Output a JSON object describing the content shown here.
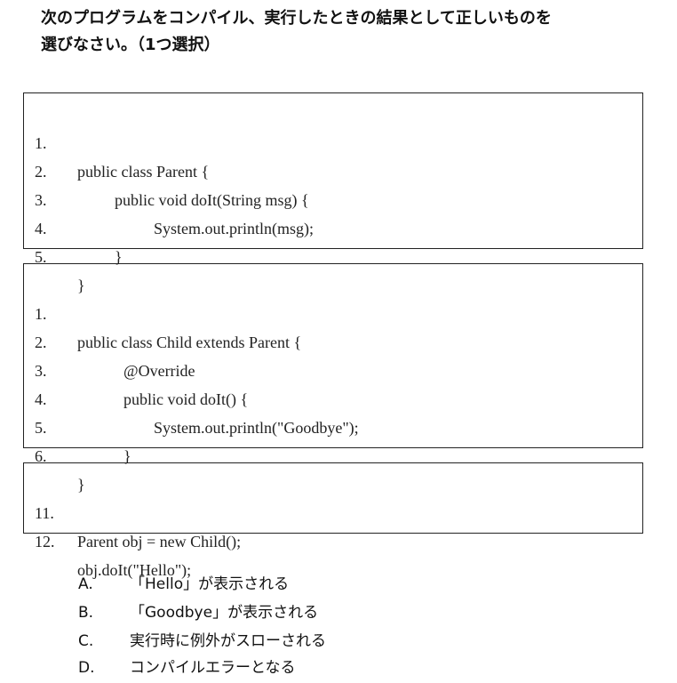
{
  "question": {
    "line1": "次のプログラムをコンパイル、実行したときの結果として正しいものを",
    "line2": "選びなさい。（1つ選択）"
  },
  "code_blocks": [
    {
      "lines": [
        {
          "no": "1.",
          "text": "public class Parent {"
        },
        {
          "no": "2.",
          "text": "public void doIt(String msg) {"
        },
        {
          "no": "3.",
          "text": "System.out.println(msg);"
        },
        {
          "no": "4.",
          "text": "}"
        },
        {
          "no": "5.",
          "text": "}"
        }
      ]
    },
    {
      "lines": [
        {
          "no": "1.",
          "text": "public class Child extends Parent {"
        },
        {
          "no": "2.",
          "text": "@Override"
        },
        {
          "no": "3.",
          "text": "public void doIt() {"
        },
        {
          "no": "4.",
          "text": "System.out.println(\"Goodbye\");"
        },
        {
          "no": "5.",
          "text": "}"
        },
        {
          "no": "6.",
          "text": "}"
        }
      ]
    },
    {
      "lines": [
        {
          "no": "11.",
          "text": "Parent obj = new Child();"
        },
        {
          "no": "12.",
          "text": "obj.doIt(\"Hello\");"
        }
      ]
    }
  ],
  "options": [
    {
      "letter": "A.",
      "text": "「Hello」が表示される"
    },
    {
      "letter": "B.",
      "text": "「Goodbye」が表示される"
    },
    {
      "letter": "C.",
      "text": "実行時に例外がスローされる"
    },
    {
      "letter": "D.",
      "text": "コンパイルエラーとなる"
    }
  ]
}
